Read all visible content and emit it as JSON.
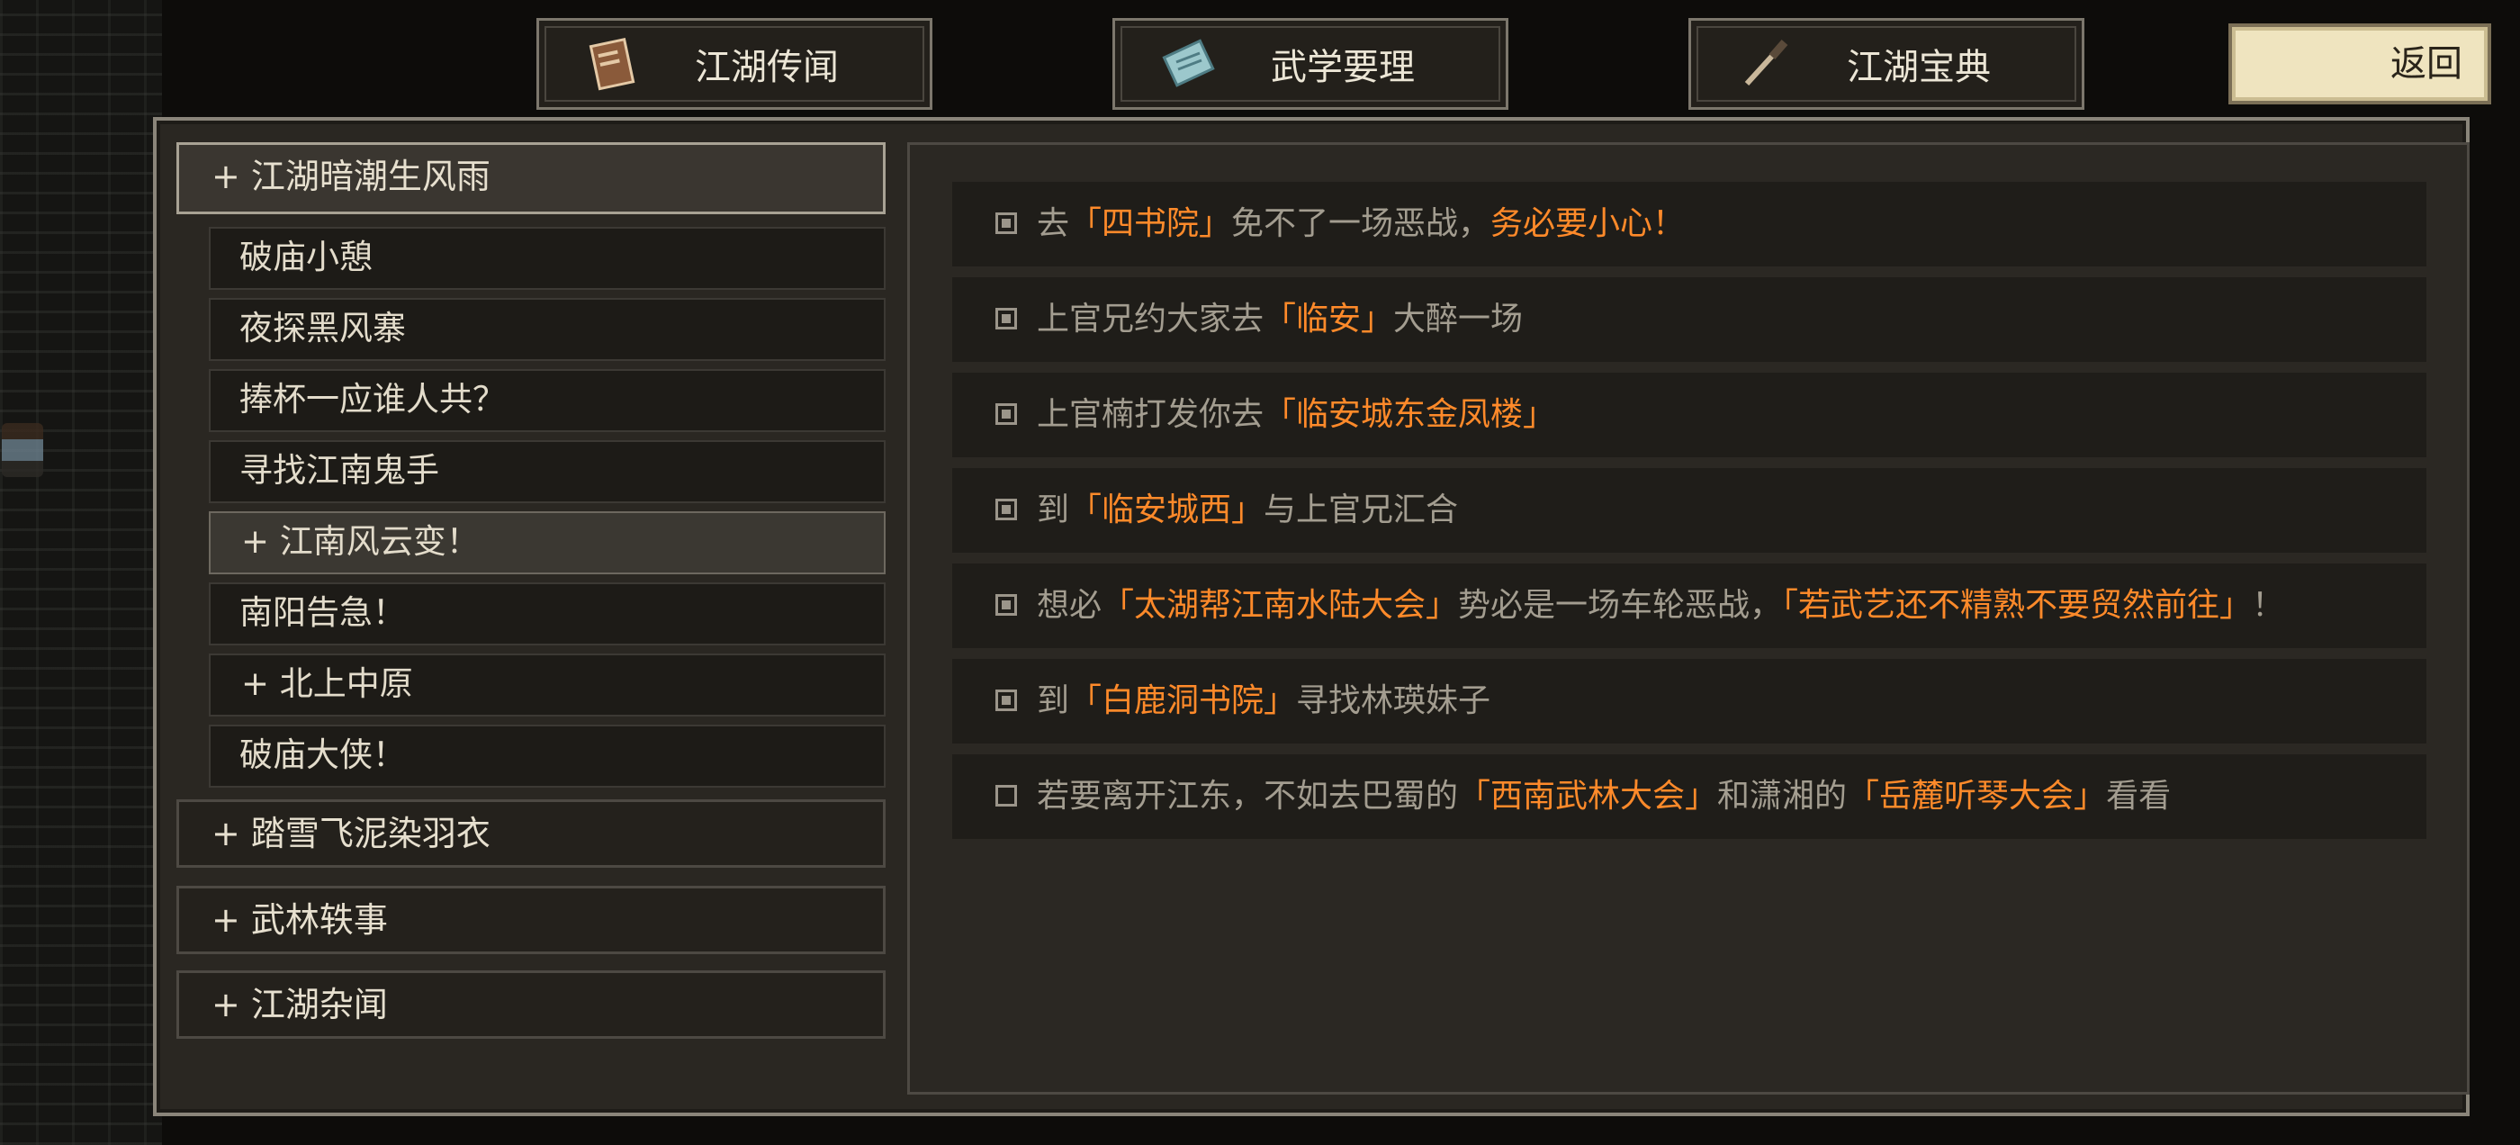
{
  "tabs": [
    {
      "label": "江湖传闻",
      "icon": "book-icon"
    },
    {
      "label": "武学要理",
      "icon": "scroll-icon"
    },
    {
      "label": "江湖宝典",
      "icon": "brush-icon"
    }
  ],
  "back_label": "返回",
  "sidebar": {
    "categories": [
      {
        "label": "+ 江湖暗潮生风雨",
        "expanded": true
      },
      {
        "label": "+ 踏雪飞泥染羽衣",
        "expanded": false
      },
      {
        "label": "+ 武林轶事",
        "expanded": false
      },
      {
        "label": "+ 江湖杂闻",
        "expanded": false
      }
    ],
    "quests": [
      {
        "label": "破庙小憩"
      },
      {
        "label": "夜探黑风寨"
      },
      {
        "label": "捧杯一应谁人共？"
      },
      {
        "label": "寻找江南鬼手"
      },
      {
        "label": "+ 江南风云变！",
        "selected": true
      },
      {
        "label": "南阳告急！"
      },
      {
        "label": "+ 北上中原"
      },
      {
        "label": "破庙大侠！"
      }
    ]
  },
  "objectives": [
    {
      "done": true,
      "parts": [
        "去",
        "「四书院」",
        "免不了一场恶战，",
        "务必要小心！"
      ]
    },
    {
      "done": true,
      "parts": [
        "上官兄约大家去",
        "「临安」",
        "大醉一场"
      ]
    },
    {
      "done": true,
      "parts": [
        "上官楠打发你去",
        "「临安城东金凤楼」"
      ]
    },
    {
      "done": true,
      "parts": [
        "到",
        "「临安城西」",
        "与上官兄汇合"
      ]
    },
    {
      "done": true,
      "parts": [
        "想必",
        "「太湖帮江南水陆大会」",
        "势必是一场车轮恶战，",
        "「若武艺还不精熟不要贸然前往」",
        "！"
      ]
    },
    {
      "done": true,
      "parts": [
        "到",
        "「白鹿洞书院」",
        "寻找林瑛妹子"
      ]
    },
    {
      "done": false,
      "parts": [
        "若要离开江东，不如去巴蜀的",
        "「西南武林大会」",
        "和潇湘的",
        "「岳麓听琴大会」",
        "看看"
      ]
    }
  ],
  "colors": {
    "highlight": "#ff8a2a",
    "text_dim": "#a39d90",
    "back_button": "#efe4bf"
  }
}
